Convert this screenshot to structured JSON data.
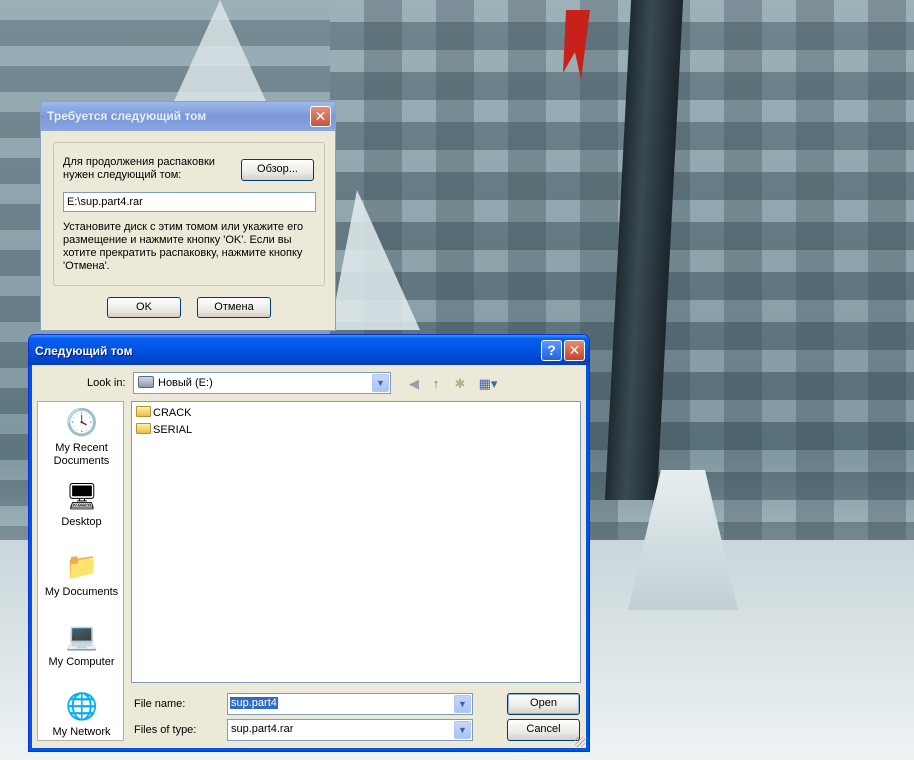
{
  "colors": {
    "xp_titlebar": "#0055e5",
    "dialog_face": "#ece9d8",
    "selection": "#316ac5"
  },
  "volume_dialog": {
    "title": "Требуется следующий том",
    "message": "Для продолжения распаковки нужен следующий том:",
    "browse_label": "Обзор...",
    "path_value": "E:\\sup.part4.rar",
    "info": "Установите диск с этим томом или укажите его размещение и нажмите кнопку 'OK'.  Если вы хотите прекратить распаковку, нажмите кнопку 'Отмена'.",
    "ok_label": "OK",
    "cancel_label": "Отмена",
    "close_icon": "close-icon"
  },
  "file_dialog": {
    "title": "Следующий том",
    "look_in_label": "Look in:",
    "look_in_value": "Новый (E:)",
    "toolbar_icons": [
      "back-icon",
      "up-folder-icon",
      "new-folder-icon",
      "views-menu-icon"
    ],
    "places": [
      {
        "label": "My Recent Documents",
        "icon": "recent-documents-icon"
      },
      {
        "label": "Desktop",
        "icon": "desktop-icon"
      },
      {
        "label": "My Documents",
        "icon": "my-documents-icon"
      },
      {
        "label": "My Computer",
        "icon": "my-computer-icon"
      },
      {
        "label": "My Network",
        "icon": "my-network-icon"
      }
    ],
    "files": [
      {
        "name": "CRACK",
        "icon": "folder-icon"
      },
      {
        "name": "SERIAL",
        "icon": "folder-icon"
      }
    ],
    "file_name_label": "File name:",
    "file_name_value": "sup.part4",
    "files_of_type_label": "Files of type:",
    "files_of_type_value": "sup.part4.rar",
    "open_label": "Open",
    "cancel_label": "Cancel"
  }
}
